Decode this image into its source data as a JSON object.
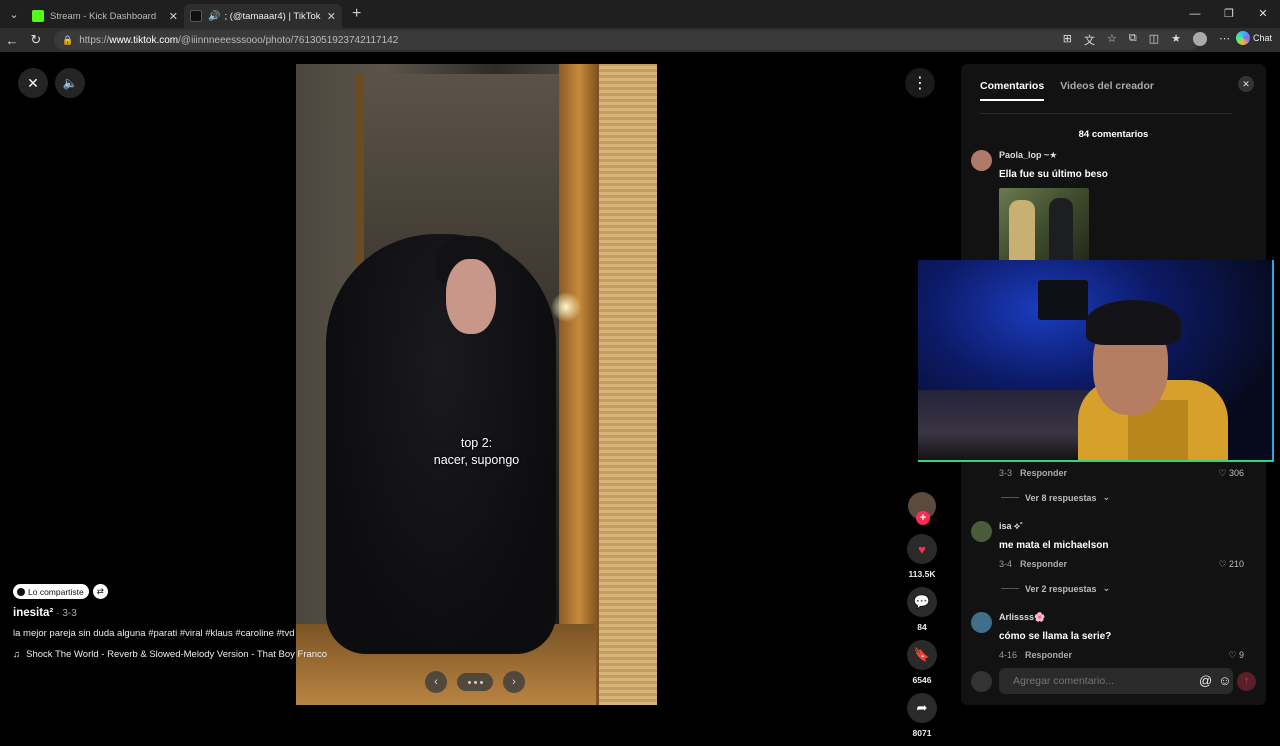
{
  "browser": {
    "tabs": [
      {
        "title": "Stream - Kick Dashboard",
        "favicon_color": "#53fc18",
        "active": false
      },
      {
        "title": "; (@tamaaar4) | TikTok",
        "favicon_color": "#ffffff",
        "active": true
      }
    ],
    "url_prefix": "https://",
    "url_domain": "www.tiktok.com",
    "url_path": "/@iiinnneeesssooo/photo/7613051923742117142",
    "chat_label": "Chat"
  },
  "post": {
    "overlay_line1": "top 2:",
    "overlay_line2": "nacer, supongo",
    "shared_chip": "Lo compartiste",
    "author": "inesita²",
    "date": "· 3-3",
    "description": "la mejor pareja sin duda alguna #parati #viral #klaus #caroline #tvd",
    "music": "Shock The World - Reverb & Slowed-Melody Version - That Boy Franco"
  },
  "actions": {
    "likes": "113.5K",
    "comments": "84",
    "saves": "6546",
    "shares": "8071"
  },
  "panel": {
    "tab_comments": "Comentarios",
    "tab_creator": "Videos del creador",
    "count": "84 comentarios",
    "comments": [
      {
        "name": "Paola_lop ~★",
        "text": "Ella fue su último beso"
      },
      {
        "date": "3-3",
        "reply": "Responder",
        "likes": "306",
        "replies": "Ver 8 respuestas"
      },
      {
        "name": "isa ⟡˚",
        "text": "me mata el michaelson",
        "date": "3-4",
        "reply": "Responder",
        "likes": "210",
        "replies": "Ver 2 respuestas"
      },
      {
        "name": "Arlissss🌸",
        "text": "cómo se llama la serie?",
        "date": "4-16",
        "reply": "Responder",
        "likes": "9"
      }
    ],
    "input_placeholder": "Agregar comentario..."
  },
  "colors": {
    "like": "#fe2c55",
    "panel_bg": "#121212",
    "accent_green": "#3ad07a"
  }
}
